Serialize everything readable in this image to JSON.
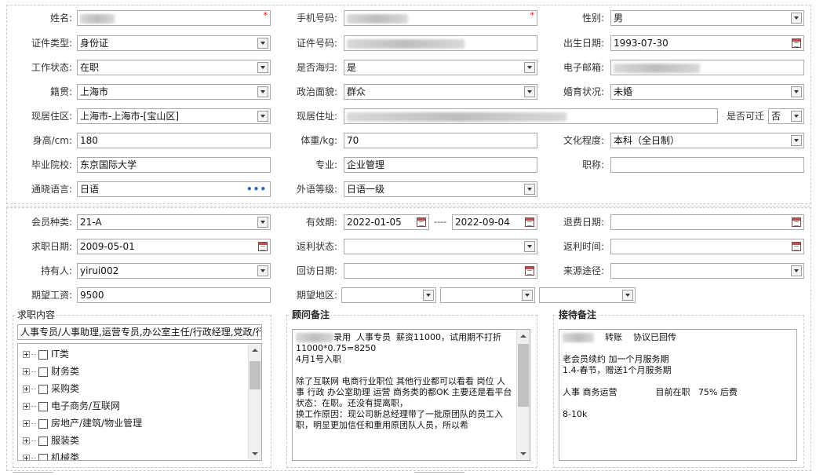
{
  "section1": {
    "name": {
      "label": "姓名:"
    },
    "phone": {
      "label": "手机号码:"
    },
    "gender": {
      "label": "性别:",
      "value": "男"
    },
    "id_type": {
      "label": "证件类型:",
      "value": "身份证"
    },
    "id_number": {
      "label": "证件号码:"
    },
    "birth_date": {
      "label": "出生日期:",
      "value": "1993-07-30"
    },
    "work_status": {
      "label": "工作状态:",
      "value": "在职"
    },
    "returnee": {
      "label": "是否海归:",
      "value": "是"
    },
    "email": {
      "label": "电子邮箱:"
    },
    "native_place": {
      "label": "籍贯:",
      "value": "上海市"
    },
    "political": {
      "label": "政治面貌:",
      "value": "群众"
    },
    "marital": {
      "label": "婚育状况:",
      "value": "未婚"
    },
    "residence_area": {
      "label": "现居住区:",
      "value": "上海市-上海市-[宝山区]"
    },
    "residence_address": {
      "label": "现居住址:"
    },
    "relocate": {
      "label": "是否可迁",
      "value": "否"
    },
    "height": {
      "label": "身高/cm:",
      "value": "180"
    },
    "weight": {
      "label": "体重/kg:",
      "value": "70"
    },
    "education": {
      "label": "文化程度:",
      "value": "本科（全日制）"
    },
    "school": {
      "label": "毕业院校:",
      "value": "东京国际大学"
    },
    "major": {
      "label": "专业:",
      "value": "企业管理"
    },
    "title": {
      "label": "职称:",
      "value": ""
    },
    "language": {
      "label": "通晓语言:",
      "value": "日语"
    },
    "foreign_level": {
      "label": "外语等级:",
      "value": "日语一级"
    }
  },
  "section2": {
    "member_type": {
      "label": "会员种类:",
      "value": "21-A"
    },
    "valid_period": {
      "label": "有效期:",
      "start": "2022-01-05",
      "separator": "----",
      "end": "2022-09-04"
    },
    "refund_date": {
      "label": "退费日期:",
      "value": ""
    },
    "job_date": {
      "label": "求职日期:",
      "value": "2009-05-01"
    },
    "rebate_status": {
      "label": "返利状态:",
      "value": ""
    },
    "rebate_time": {
      "label": "返利时间:",
      "value": ""
    },
    "holder": {
      "label": "持有人:",
      "value": "yirui002"
    },
    "visit_date": {
      "label": "回访日期:",
      "value": ""
    },
    "source": {
      "label": "来源途径:",
      "value": ""
    },
    "expected_salary": {
      "label": "期望工资:",
      "value": "9500"
    },
    "expected_area": {
      "label": "期望地区:"
    }
  },
  "job_content": {
    "legend": "求职内容",
    "selected": "人事专员/人事助理,运营专员,办公室主任/行政经理,党政/行政",
    "tree": [
      "IT类",
      "财务类",
      "采购类",
      "电子商务/互联网",
      "房地产/建筑/物业管理",
      "服装类",
      "机械类"
    ]
  },
  "consultant_notes": {
    "legend": "顾问备注",
    "text": "录用  人事专员  薪资11000，试用期不打折\n11000*0.75=8250\n4月1号入职\n\n除了互联网 电商行业职位 其他行业都可以看看 岗位 人事 行政 办公室助理 运营 商务类的都OK 主要还是看平台\n状态：在职。还没有提离职，\n换工作原因：现公司新总经理带了一批原团队的员工入职，明显更加信任和重用原团队人员，所以希"
  },
  "reception_notes": {
    "legend": "接待备注",
    "text": "    转账    协议已回传\n\n老会员续约 加一个月服务期\n1.4-春节，赠送1个月服务期\n\n人事 商务运营              目前在职   75% 后费\n\n8-10k"
  }
}
